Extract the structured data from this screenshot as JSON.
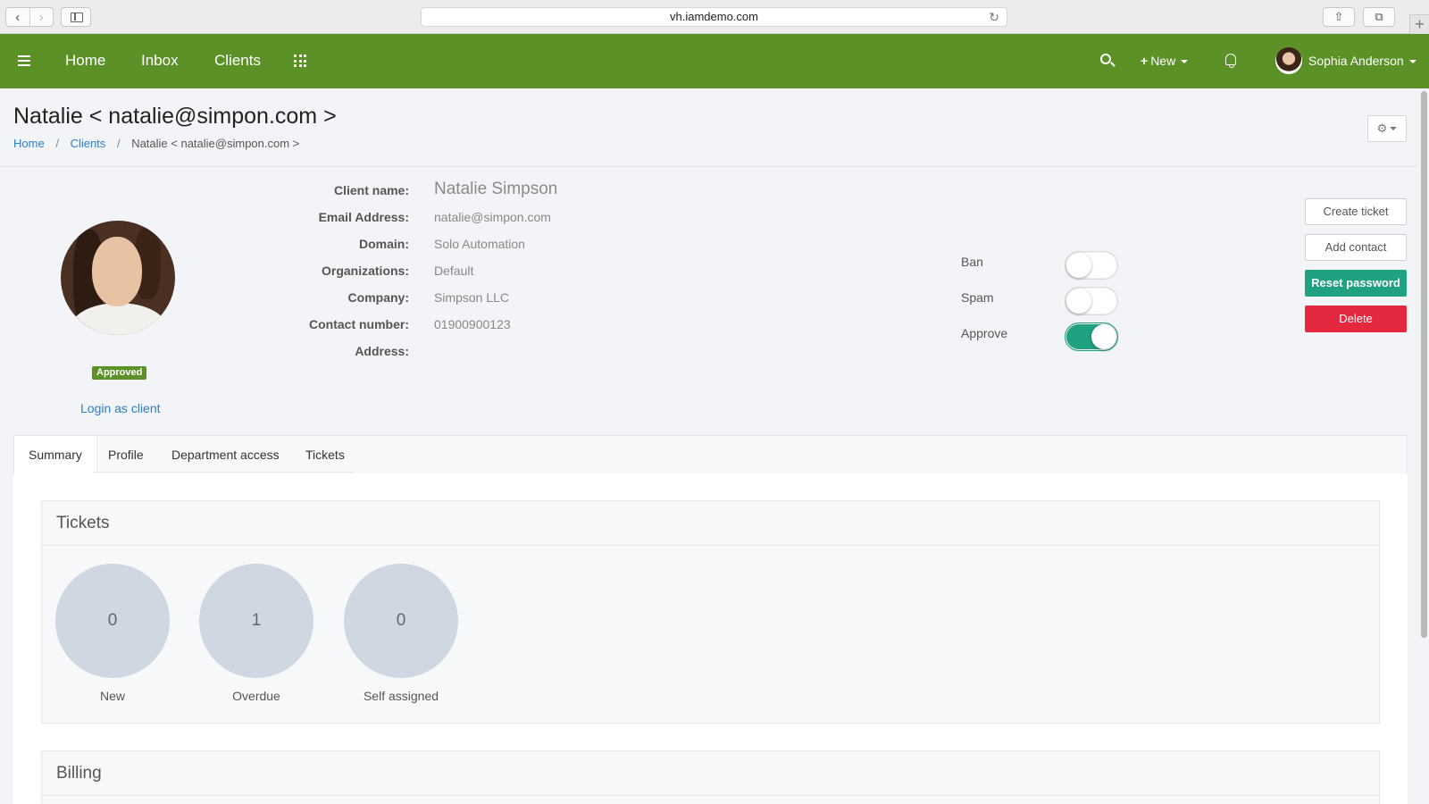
{
  "browser": {
    "url": "vh.iamdemo.com"
  },
  "header": {
    "nav": [
      "Home",
      "Inbox",
      "Clients"
    ],
    "new_label": "New",
    "user_name": "Sophia Anderson"
  },
  "page": {
    "title": "Natalie < natalie@simpon.com >",
    "breadcrumb": [
      "Home",
      "Clients",
      "Natalie < natalie@simpon.com >"
    ]
  },
  "profile": {
    "status_badge": "Approved",
    "login_link": "Login as client",
    "fields": [
      {
        "label": "Client name:",
        "value": "Natalie Simpson"
      },
      {
        "label": "Email Address:",
        "value": "natalie@simpon.com"
      },
      {
        "label": "Domain:",
        "value": "Solo Automation"
      },
      {
        "label": "Organizations:",
        "value": "Default"
      },
      {
        "label": "Company:",
        "value": "Simpson LLC"
      },
      {
        "label": "Contact number:",
        "value": "01900900123"
      },
      {
        "label": "Address:",
        "value": ""
      }
    ]
  },
  "toggles": [
    {
      "label": "Ban",
      "on": false
    },
    {
      "label": "Spam",
      "on": false
    },
    {
      "label": "Approve",
      "on": true
    }
  ],
  "actions": {
    "create_ticket": "Create ticket",
    "add_contact": "Add contact",
    "reset_password": "Reset password",
    "delete": "Delete"
  },
  "tabs": [
    "Summary",
    "Profile",
    "Department access",
    "Tickets"
  ],
  "tickets_panel": {
    "title": "Tickets",
    "stats": [
      {
        "value": "0",
        "label": "New"
      },
      {
        "value": "1",
        "label": "Overdue"
      },
      {
        "value": "0",
        "label": "Self assigned"
      }
    ]
  },
  "billing_panel": {
    "title": "Billing"
  },
  "colors": {
    "header_green": "#5b9127",
    "accent_teal": "#1fa182",
    "danger_red": "#e3283f",
    "link_blue": "#2a7fc9"
  }
}
